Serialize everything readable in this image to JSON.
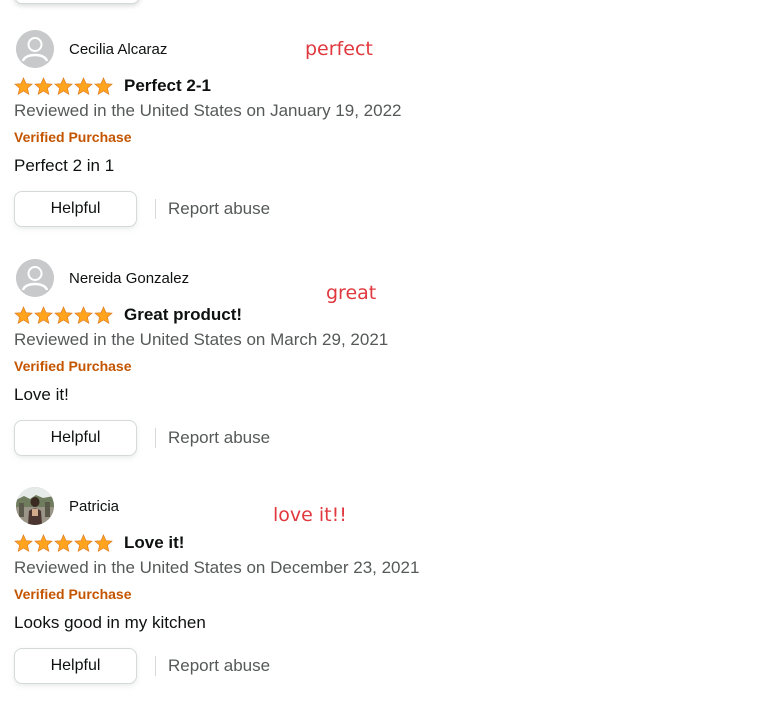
{
  "reviews": [
    {
      "author": "Cecilia Alcaraz",
      "annotation": "perfect",
      "rating": 5,
      "title": "Perfect 2-1",
      "meta": "Reviewed in the United States on January 19, 2022",
      "verified": "Verified Purchase",
      "body": "Perfect 2 in 1",
      "helpful_label": "Helpful",
      "report_label": "Report abuse",
      "avatar": "default-avatar"
    },
    {
      "author": "Nereida Gonzalez",
      "annotation": "great",
      "rating": 5,
      "title": "Great product!",
      "meta": "Reviewed in the United States on March 29, 2021",
      "verified": "Verified Purchase",
      "body": "Love it!",
      "helpful_label": "Helpful",
      "report_label": "Report abuse",
      "avatar": "default-avatar"
    },
    {
      "author": "Patricia",
      "annotation": "love it!!",
      "rating": 5,
      "title": "Love it!",
      "meta": "Reviewed in the United States on December 23, 2021",
      "verified": "Verified Purchase",
      "body": "Looks good in my kitchen",
      "helpful_label": "Helpful",
      "report_label": "Report abuse",
      "avatar": "photo-avatar"
    }
  ],
  "colors": {
    "star": "#ffa41c",
    "verified": "#c45500",
    "annotation": "#e0383e",
    "meta": "#565959"
  }
}
